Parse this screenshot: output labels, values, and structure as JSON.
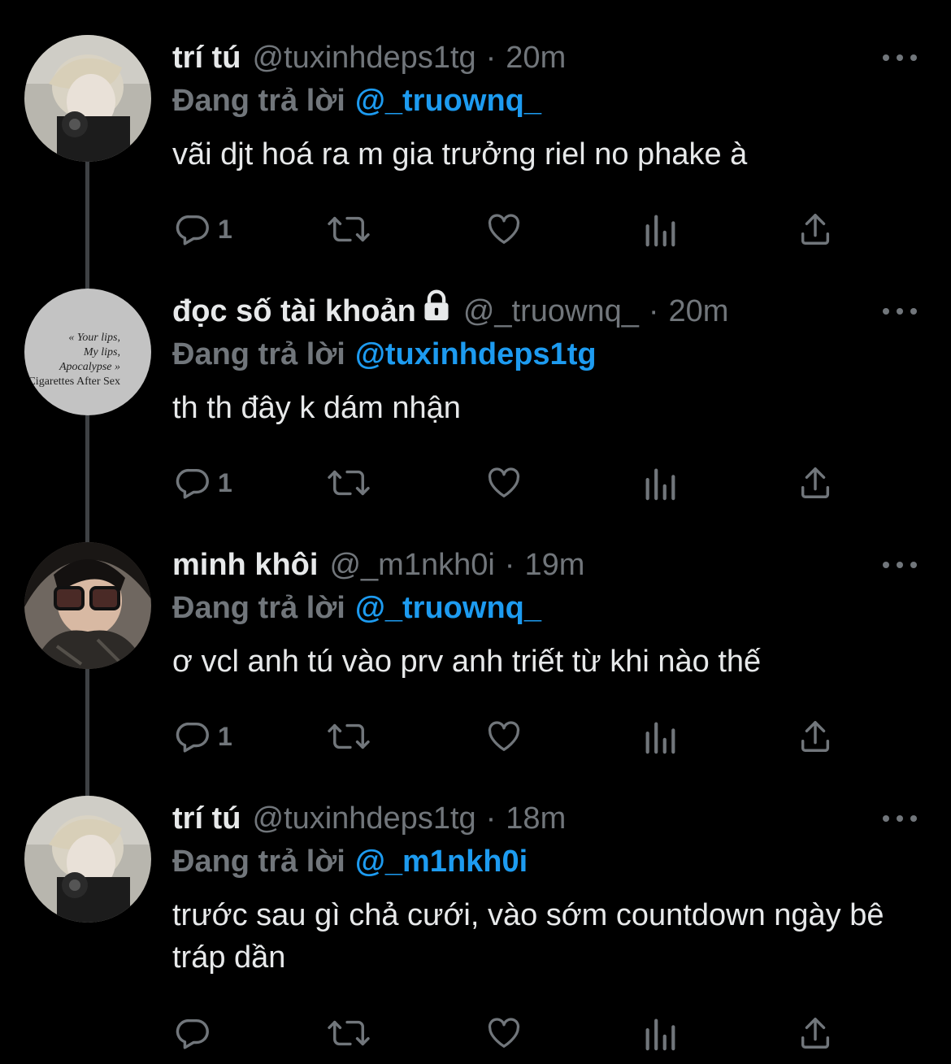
{
  "tweets": [
    {
      "name": "trí tú",
      "locked": false,
      "handle": "@tuxinhdeps1tg",
      "separator": "·",
      "time": "20m",
      "reply_label": "Đang trả lời",
      "reply_to": "@_truownq_",
      "text": "vãi djt hoá ra m gia trưởng riel no phake à",
      "reply_count": "1",
      "avatar": "portrait-photo-light-hair"
    },
    {
      "name": "đọc số tài khoản",
      "locked": true,
      "handle": "@_truownq_",
      "separator": "·",
      "time": "20m",
      "reply_label": "Đang trả lời",
      "reply_to": "@tuxinhdeps1tg",
      "text": "th th đây k dám nhận",
      "reply_count": "1",
      "avatar": "album-cover-text",
      "avatar_text": [
        "« Your lips,",
        "My lips,",
        "Apocalypse »",
        "Cigarettes After Sex"
      ]
    },
    {
      "name": "minh khôi",
      "locked": false,
      "handle": "@_m1nkh0i",
      "separator": "·",
      "time": "19m",
      "reply_label": "Đang trả lời",
      "reply_to": "@_truownq_",
      "text": "ơ vcl anh tú vào prv anh triết từ khi nào thế",
      "reply_count": "1",
      "avatar": "portrait-photo-glasses"
    },
    {
      "name": "trí tú",
      "locked": false,
      "handle": "@tuxinhdeps1tg",
      "separator": "·",
      "time": "18m",
      "reply_label": "Đang trả lời",
      "reply_to": "@_m1nkh0i",
      "text": "trước sau gì chả cưới, vào sớm countdown ngày bê tráp dần",
      "reply_count": "",
      "avatar": "portrait-photo-light-hair"
    }
  ],
  "colors": {
    "background": "#000000",
    "primary_text": "#e7e9ea",
    "secondary_text": "#71767b",
    "link": "#1d9bf0",
    "thread_line": "#3e4144"
  }
}
